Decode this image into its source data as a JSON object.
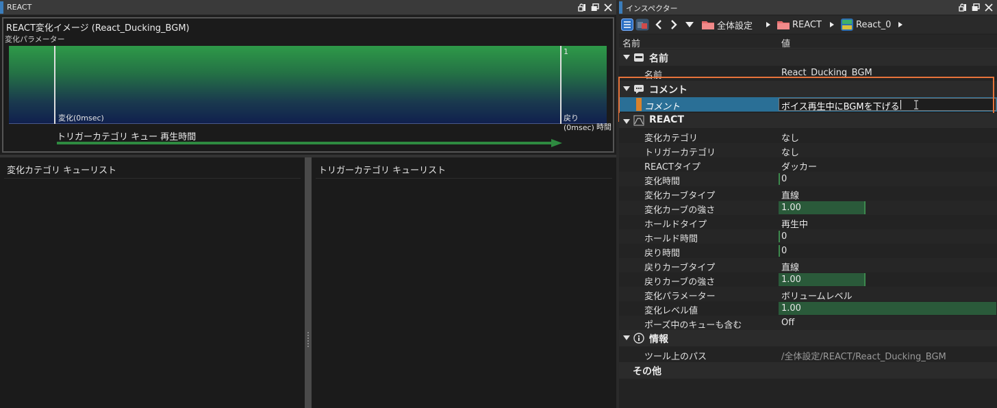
{
  "react_panel": {
    "title": "REACT",
    "graph_title": "REACT変化イメージ (React_Ducking_BGM)",
    "graph_subtitle": "変化パラメーター",
    "y_top_label": "1",
    "change_label": "変化(0msec)",
    "return_label": "戻り(0msec)",
    "time_label": "時間",
    "trigger_label": "トリガーカテゴリ キュー 再生時間"
  },
  "lower_panes": {
    "left_title": "変化カテゴリ キューリスト",
    "right_title": "トリガーカテゴリ キューリスト"
  },
  "inspector": {
    "title": "インスペクター",
    "breadcrumb": [
      "全体設定",
      "REACT",
      "React_0"
    ],
    "col_name": "名前",
    "col_value": "値",
    "sections": {
      "name_section": "名前",
      "comment_section": "コメント",
      "react_section": "REACT",
      "info_section": "情報",
      "other_section": "その他"
    },
    "name_row": {
      "label": "名前",
      "value": "React_Ducking_BGM"
    },
    "comment_row": {
      "label": "コメント",
      "value": "ボイス再生中にBGMを下げる"
    },
    "react_rows": [
      {
        "label": "変化カテゴリ",
        "value": "なし"
      },
      {
        "label": "トリガーカテゴリ",
        "value": "なし"
      },
      {
        "label": "REACTタイプ",
        "value": "ダッカー"
      },
      {
        "label": "変化時間",
        "value": "0"
      },
      {
        "label": "変化カーブタイプ",
        "value": "直線"
      },
      {
        "label": "変化カーブの強さ",
        "value": "1.00"
      },
      {
        "label": "ホールドタイプ",
        "value": "再生中"
      },
      {
        "label": "ホールド時間",
        "value": "0"
      },
      {
        "label": "戻り時間",
        "value": "0"
      },
      {
        "label": "戻りカーブタイプ",
        "value": "直線"
      },
      {
        "label": "戻りカーブの強さ",
        "value": "1.00"
      },
      {
        "label": "変化パラメーター",
        "value": "ボリュームレベル"
      },
      {
        "label": "変化レベル値",
        "value": "1.00"
      },
      {
        "label": "ポーズ中のキューも含む",
        "value": "Off"
      }
    ],
    "info_row": {
      "label": "ツール上のパス",
      "value": "/全体設定/REACT/React_Ducking_BGM"
    }
  },
  "colors": {
    "highlight_border": "#e8733a",
    "selected_row": "#2a6f96",
    "accent_blue": "#3b7dbb"
  }
}
